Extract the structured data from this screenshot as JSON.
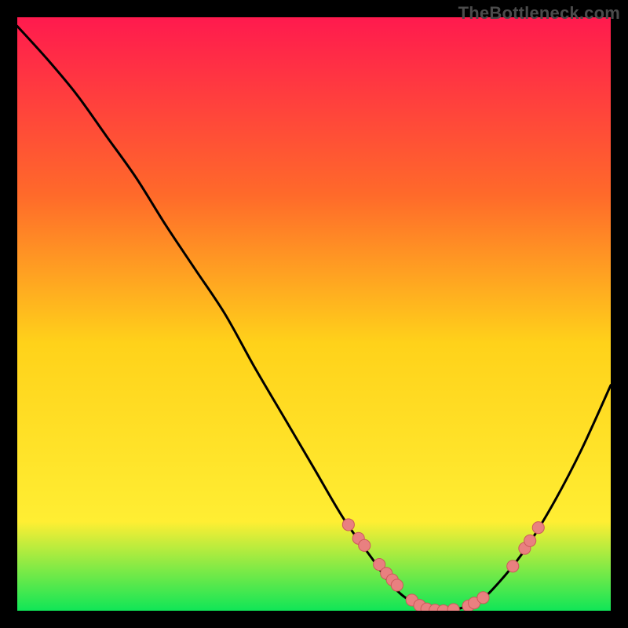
{
  "watermark": "TheBottleneck.com",
  "colors": {
    "background": "#000000",
    "gradient_top": "#ff1a4e",
    "gradient_mid_upper": "#ff6a2a",
    "gradient_mid": "#ffd21a",
    "gradient_mid_lower": "#ffee33",
    "gradient_bottom": "#10e657",
    "curve": "#000000",
    "dot_fill": "#e98080",
    "dot_stroke": "#cc5a5a"
  },
  "chart_data": {
    "type": "line",
    "title": "",
    "xlabel": "",
    "ylabel": "",
    "x": [
      0.0,
      0.05,
      0.1,
      0.15,
      0.2,
      0.25,
      0.3,
      0.35,
      0.4,
      0.45,
      0.5,
      0.55,
      0.6,
      0.625,
      0.65,
      0.675,
      0.7,
      0.725,
      0.75,
      0.775,
      0.8,
      0.85,
      0.9,
      0.95,
      1.0
    ],
    "values": [
      0.985,
      0.93,
      0.87,
      0.8,
      0.73,
      0.65,
      0.575,
      0.5,
      0.41,
      0.325,
      0.24,
      0.155,
      0.085,
      0.05,
      0.025,
      0.01,
      0.0,
      0.0,
      0.005,
      0.015,
      0.035,
      0.095,
      0.175,
      0.27,
      0.38
    ],
    "xlim": [
      0,
      1
    ],
    "ylim": [
      0,
      1
    ],
    "dots": [
      {
        "x": 0.558,
        "y": 0.145
      },
      {
        "x": 0.575,
        "y": 0.122
      },
      {
        "x": 0.585,
        "y": 0.11
      },
      {
        "x": 0.61,
        "y": 0.078
      },
      {
        "x": 0.622,
        "y": 0.063
      },
      {
        "x": 0.632,
        "y": 0.052
      },
      {
        "x": 0.64,
        "y": 0.043
      },
      {
        "x": 0.665,
        "y": 0.018
      },
      {
        "x": 0.678,
        "y": 0.009
      },
      {
        "x": 0.69,
        "y": 0.003
      },
      {
        "x": 0.704,
        "y": 0.001
      },
      {
        "x": 0.718,
        "y": 0.0
      },
      {
        "x": 0.735,
        "y": 0.002
      },
      {
        "x": 0.76,
        "y": 0.008
      },
      {
        "x": 0.77,
        "y": 0.013
      },
      {
        "x": 0.785,
        "y": 0.022
      },
      {
        "x": 0.835,
        "y": 0.075
      },
      {
        "x": 0.855,
        "y": 0.105
      },
      {
        "x": 0.864,
        "y": 0.118
      },
      {
        "x": 0.878,
        "y": 0.14
      }
    ],
    "dot_radius_norm": 0.01
  }
}
